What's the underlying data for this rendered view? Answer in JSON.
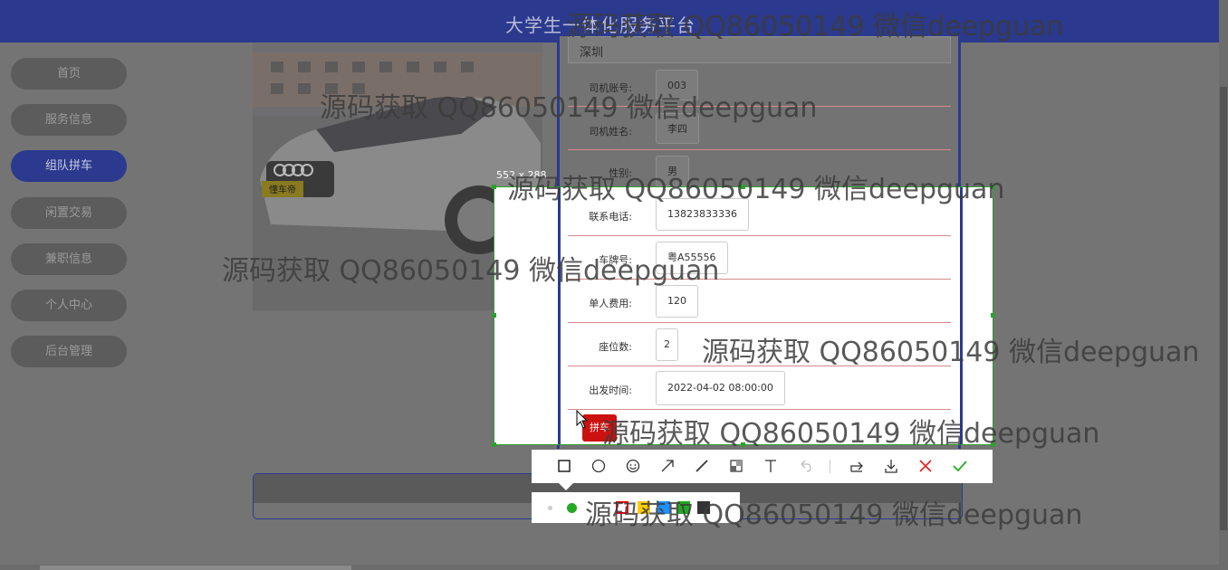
{
  "header": {
    "title": "大学生一体化服务平台"
  },
  "sidebar": {
    "items": [
      {
        "label": "首页"
      },
      {
        "label": "服务信息"
      },
      {
        "label": "组队拼车"
      },
      {
        "label": "闲置交易"
      },
      {
        "label": "兼职信息"
      },
      {
        "label": "个人中心"
      },
      {
        "label": "后台管理"
      }
    ]
  },
  "detail": {
    "city": "深圳",
    "fields": [
      {
        "label": "司机账号:",
        "value": "003"
      },
      {
        "label": "司机姓名:",
        "value": "李四"
      },
      {
        "label": "性别:",
        "value": "男"
      },
      {
        "label": "联系电话:",
        "value": "13823833336"
      },
      {
        "label": "车牌号:",
        "value": "粤A55556"
      },
      {
        "label": "单人费用:",
        "value": "120"
      },
      {
        "label": "座位数:",
        "value": "2"
      },
      {
        "label": "出发时间:",
        "value": "2022-04-02 08:00:00"
      }
    ],
    "action_label": "拼车"
  },
  "car_badge": "懂车帝",
  "screenshot_tool": {
    "size_label": "552 x 288",
    "tools": [
      "rectangle-icon",
      "circle-icon",
      "emoji-icon",
      "arrow-icon",
      "pen-icon",
      "mosaic-icon",
      "text-icon",
      "undo-icon",
      "share-icon",
      "download-icon",
      "close-icon",
      "confirm-icon"
    ],
    "colors": [
      "#ff0000",
      "#ffcc00",
      "#1e90ff",
      "#22aa22",
      "#333333"
    ]
  },
  "watermark": "源码获取 QQ86050149 微信deepguan"
}
